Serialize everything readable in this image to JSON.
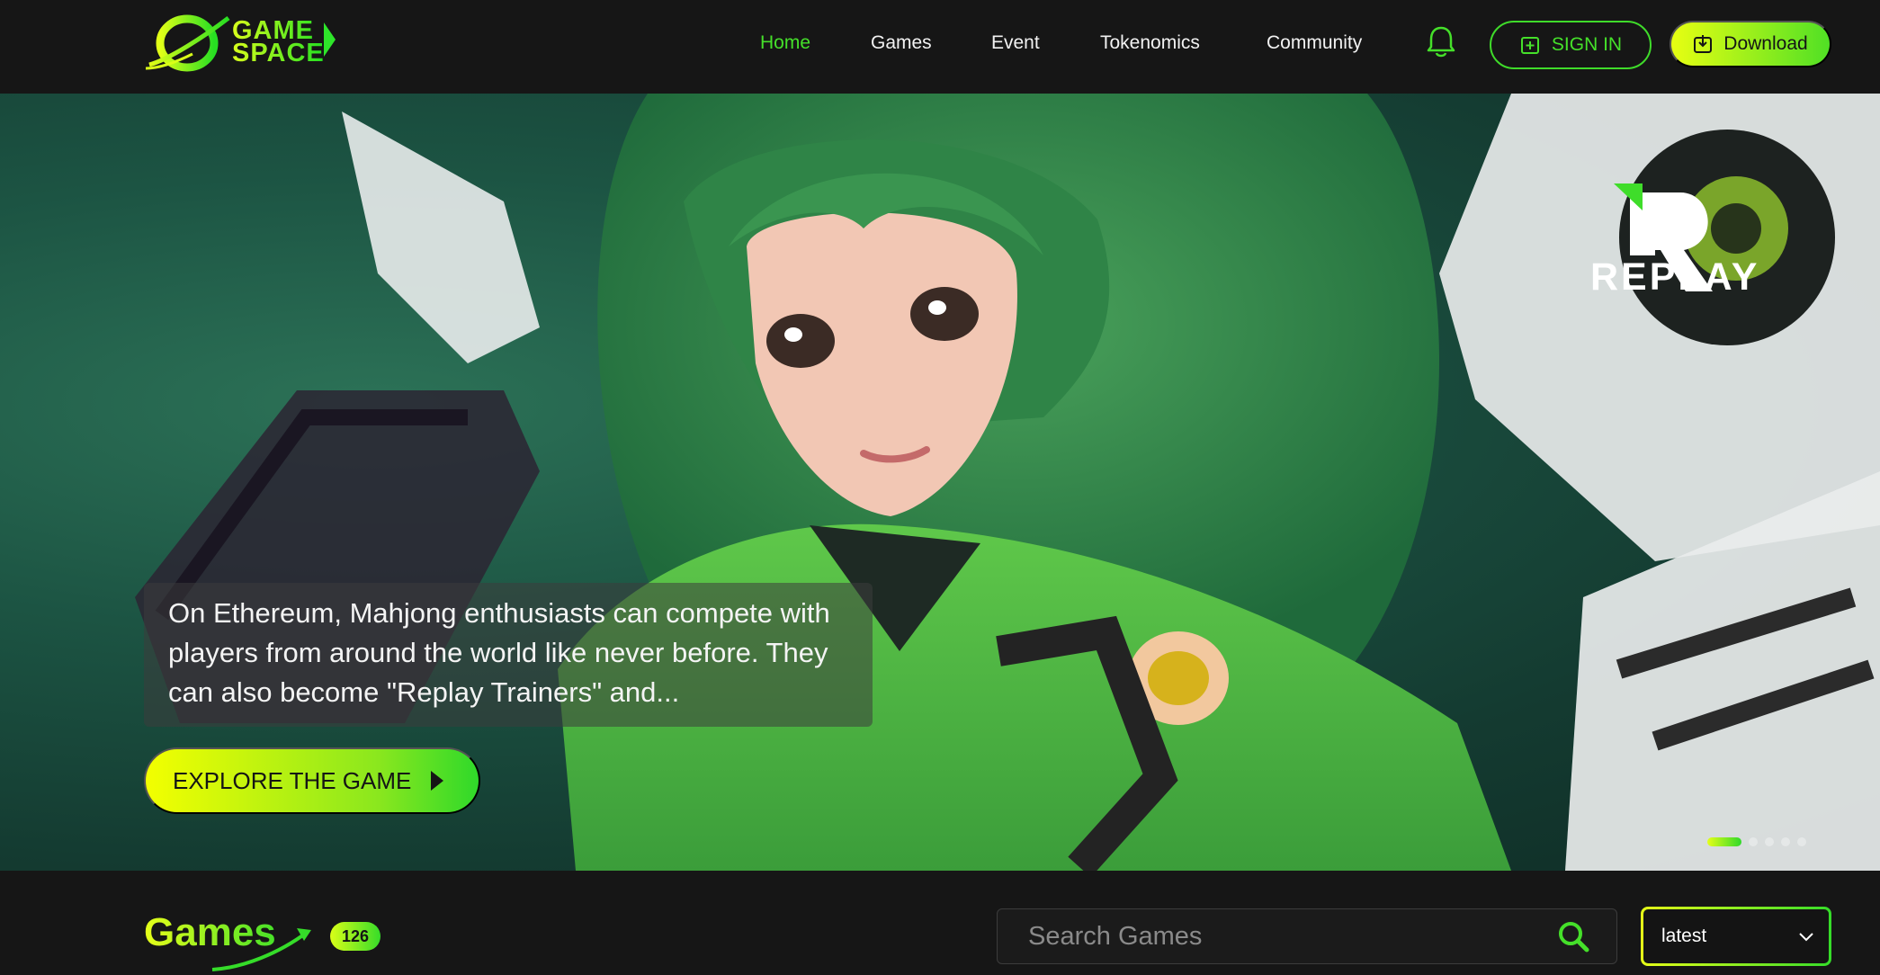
{
  "brand": {
    "line1": "GAME",
    "line2": "SPACE"
  },
  "nav": [
    {
      "label": "Home",
      "active": true
    },
    {
      "label": "Games",
      "active": false
    },
    {
      "label": "Event",
      "active": false
    },
    {
      "label": "Tokenomics",
      "active": false
    },
    {
      "label": "Community",
      "active": false
    }
  ],
  "header": {
    "signin_label": "SIGN IN",
    "download_label": "Download"
  },
  "hero": {
    "game_brand": "REPLAY",
    "description": "On Ethereum, Mahjong enthusiasts can compete with players from around the world like never before. They can also become \"Replay Trainers\" and...",
    "cta_label": "EXPLORE THE GAME",
    "slides_total": 5,
    "slide_active": 1
  },
  "games": {
    "title": "Games",
    "count": "126",
    "search_placeholder": "Search Games",
    "sort_value": "latest"
  },
  "colors": {
    "accent_green": "#45e02a",
    "accent_yellow": "#e7ff12",
    "background": "#161616"
  }
}
